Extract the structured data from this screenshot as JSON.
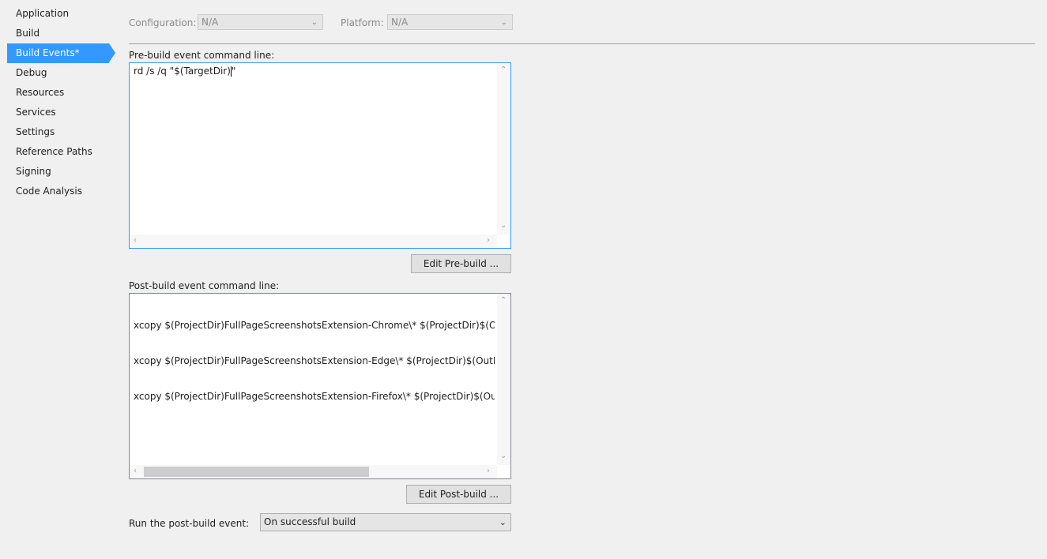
{
  "sidebar": {
    "items": [
      {
        "label": "Application"
      },
      {
        "label": "Build"
      },
      {
        "label": "Build Events*"
      },
      {
        "label": "Debug"
      },
      {
        "label": "Resources"
      },
      {
        "label": "Services"
      },
      {
        "label": "Settings"
      },
      {
        "label": "Reference Paths"
      },
      {
        "label": "Signing"
      },
      {
        "label": "Code Analysis"
      }
    ],
    "selected_index": 2
  },
  "toolbar": {
    "configuration_label": "Configuration:",
    "configuration_value": "N/A",
    "platform_label": "Platform:",
    "platform_value": "N/A"
  },
  "pre_build": {
    "label": "Pre-build event command line:",
    "text": "rd /s /q \"$(TargetDir)\"",
    "text_before_caret": "rd /s /q \"$(TargetDir)",
    "text_after_caret": "\"",
    "edit_button": "Edit Pre-build ..."
  },
  "post_build": {
    "label": "Post-build event command line:",
    "lines": [
      "xcopy $(ProjectDir)FullPageScreenshotsExtension-Chrome\\* $(ProjectDir)$(OutDir)FullPageScreenshotsExtension-Chrome",
      "xcopy $(ProjectDir)FullPageScreenshotsExtension-Edge\\* $(ProjectDir)$(OutDir)FullPageScreenshotsExtension-Edge",
      "xcopy $(ProjectDir)FullPageScreenshotsExtension-Firefox\\* $(ProjectDir)$(OutDir)FullPageScreenshotsExtension-Firefox"
    ],
    "edit_button": "Edit Post-build ..."
  },
  "run_post_build": {
    "label": "Run the post-build event:",
    "value": "On successful build"
  },
  "icons": {
    "chevron": "chevron-down-icon",
    "scroll_up": "scroll-up-icon",
    "scroll_down": "scroll-down-icon",
    "scroll_left": "scroll-left-icon",
    "scroll_right": "scroll-right-icon"
  },
  "colors": {
    "accent": "#3399ff",
    "background": "#f0f0f0"
  }
}
